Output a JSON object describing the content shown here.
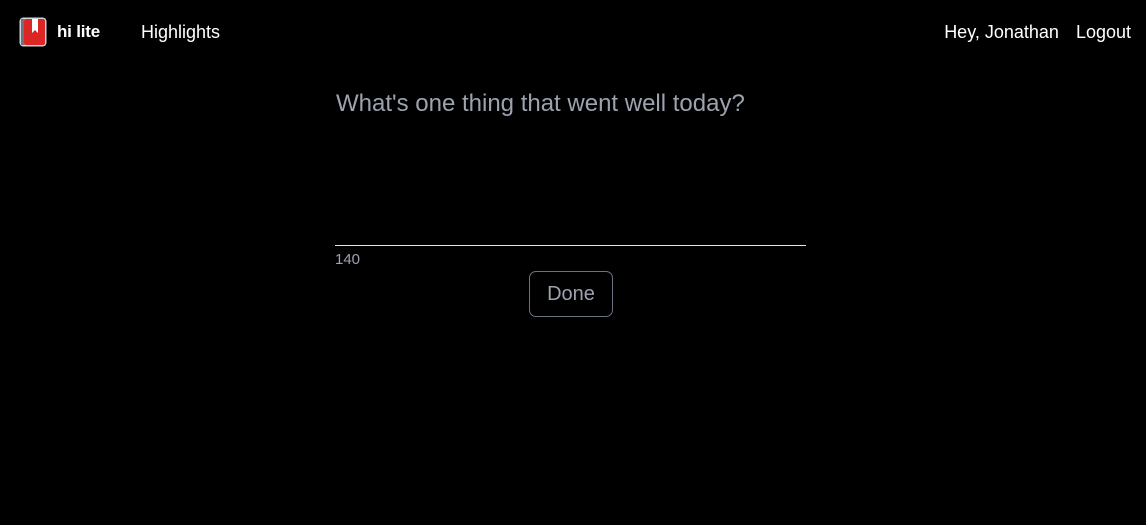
{
  "nav": {
    "brand": "hi lite",
    "highlights_link": "Highlights",
    "greeting": "Hey, Jonathan",
    "logout": "Logout"
  },
  "composer": {
    "placeholder": "What's one thing that went well today?",
    "value": "",
    "char_remaining": "140",
    "done_label": "Done"
  },
  "colors": {
    "background": "#000000",
    "text": "#ffffff",
    "muted": "#9ca3af",
    "logo_cover": "#dc2626",
    "button_border": "#6b7280"
  },
  "icons": {
    "logo": "bookmark-book-icon"
  }
}
